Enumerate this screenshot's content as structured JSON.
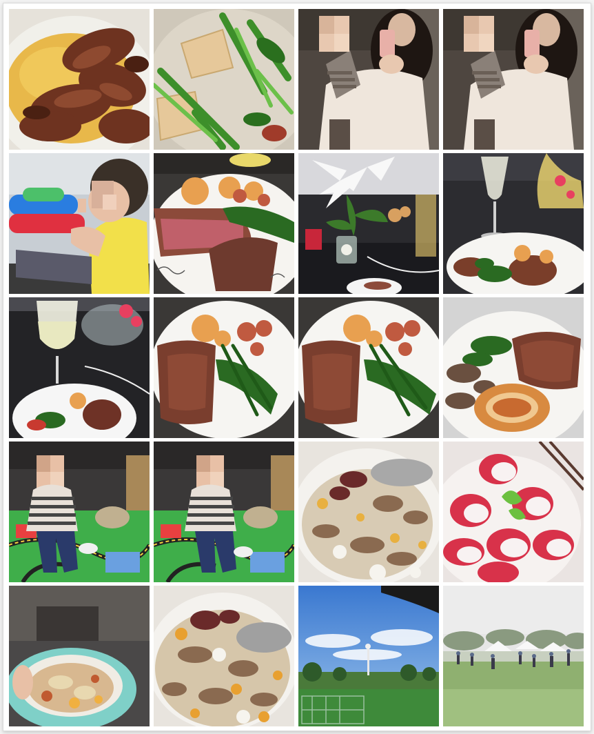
{
  "gallery": {
    "columns": 4,
    "rows": 5,
    "tiles": [
      {
        "subject": "beef-slices-plate-photo",
        "colors": {
          "bg": "#e8b84a",
          "main": "#7a3b22"
        }
      },
      {
        "subject": "tofu-greens-stirfry-photo",
        "colors": {
          "bg": "#d9d2c4",
          "main": "#3f8f2c"
        }
      },
      {
        "subject": "mirror-selfie-woman-photo",
        "colors": {
          "bg": "#5a5048",
          "main": "#efe6dc"
        }
      },
      {
        "subject": "mirror-selfie-woman-photo",
        "colors": {
          "bg": "#5a5048",
          "main": "#efe6dc"
        }
      },
      {
        "subject": "child-eating-yellow-shirt-photo",
        "colors": {
          "bg": "#cfd4d8",
          "main": "#f2e04a"
        }
      },
      {
        "subject": "steak-shrimp-greens-plate-photo",
        "colors": {
          "bg": "#f4f2ee",
          "main": "#8c4a3a"
        }
      },
      {
        "subject": "lily-flowers-table-photo",
        "colors": {
          "bg": "#2a2a2e",
          "main": "#f6f6f6"
        }
      },
      {
        "subject": "wine-glass-steak-plate-photo",
        "colors": {
          "bg": "#2c2c30",
          "main": "#f3f3f3"
        }
      },
      {
        "subject": "wine-glass-plate-table-photo",
        "colors": {
          "bg": "#252528",
          "main": "#f4f4f4"
        }
      },
      {
        "subject": "steak-shrimp-greens-plate-photo",
        "colors": {
          "bg": "#3a3836",
          "main": "#f6f5f2"
        }
      },
      {
        "subject": "steak-shrimp-greens-plate-photo",
        "colors": {
          "bg": "#3a3836",
          "main": "#f6f5f2"
        }
      },
      {
        "subject": "steak-onion-ring-plate-photo",
        "colors": {
          "bg": "#d8d8d8",
          "main": "#f6f5f2"
        }
      },
      {
        "subject": "child-striped-shirt-playmat-photo",
        "colors": {
          "bg": "#3c3a3a",
          "main": "#3fae4a"
        }
      },
      {
        "subject": "child-striped-shirt-playmat-photo",
        "colors": {
          "bg": "#3c3a3a",
          "main": "#3fae4a"
        }
      },
      {
        "subject": "rice-meat-mixed-bowl-photo",
        "colors": {
          "bg": "#f0ede8",
          "main": "#c9b79a"
        }
      },
      {
        "subject": "radish-slices-salad-photo",
        "colors": {
          "bg": "#f2ecea",
          "main": "#d8324a"
        }
      },
      {
        "subject": "teal-bowl-food-photo",
        "colors": {
          "bg": "#4a4a4a",
          "main": "#7fd0c8"
        }
      },
      {
        "subject": "rice-meat-mixed-plate-photo",
        "colors": {
          "bg": "#f0ede8",
          "main": "#c9b79a"
        }
      },
      {
        "subject": "sky-field-window-photo",
        "colors": {
          "bg": "#4e86d8",
          "main": "#3e8a3a"
        }
      },
      {
        "subject": "park-crowd-tents-photo",
        "colors": {
          "bg": "#e6e6e6",
          "main": "#8fb070"
        }
      }
    ]
  }
}
